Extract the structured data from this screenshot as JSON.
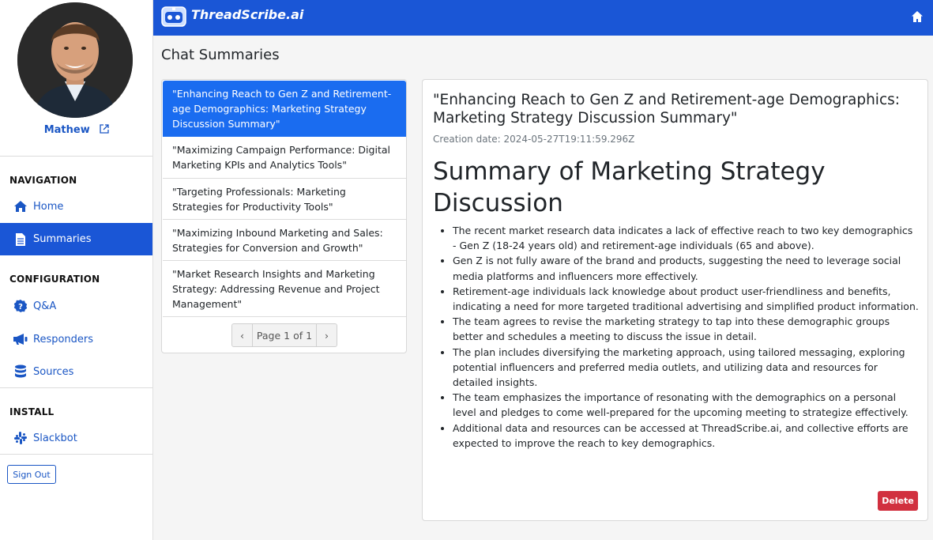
{
  "app": {
    "brand": "ThreadScribe.ai"
  },
  "user": {
    "name": "Mathew"
  },
  "sidebar": {
    "sections": {
      "navigation": "NAVIGATION",
      "configuration": "CONFIGURATION",
      "install": "INSTALL"
    },
    "items": [
      {
        "label": "Home",
        "icon": "home-icon"
      },
      {
        "label": "Summaries",
        "icon": "document-icon",
        "active": true
      },
      {
        "label": "Q&A",
        "icon": "question-icon"
      },
      {
        "label": "Responders",
        "icon": "megaphone-icon"
      },
      {
        "label": "Sources",
        "icon": "database-icon"
      },
      {
        "label": "Slackbot",
        "icon": "slack-icon"
      }
    ],
    "signout_label": "Sign Out"
  },
  "page": {
    "title": "Chat Summaries"
  },
  "summaries": [
    "\"Enhancing Reach to Gen Z and Retirement-age Demographics: Marketing Strategy Discussion Summary\"",
    "\"Maximizing Campaign Performance: Digital Marketing KPIs and Analytics Tools\"",
    "\"Targeting Professionals: Marketing Strategies for Productivity Tools\"",
    "\"Maximizing Inbound Marketing and Sales: Strategies for Conversion and Growth\"",
    "\"Market Research Insights and Marketing Strategy: Addressing Revenue and Project Management\""
  ],
  "pager": {
    "prev": "‹",
    "label": "Page 1 of 1",
    "next": "›"
  },
  "detail": {
    "title": "\"Enhancing Reach to Gen Z and Retirement-age Demographics: Marketing Strategy Discussion Summary\"",
    "creation_date": "Creation date: 2024-05-27T19:11:59.296Z",
    "heading": "Summary of Marketing Strategy Discussion",
    "bullets": [
      "The recent market research data indicates a lack of effective reach to two key demographics - Gen Z (18-24 years old) and retirement-age individuals (65 and above).",
      "Gen Z is not fully aware of the brand and products, suggesting the need to leverage social media platforms and influencers more effectively.",
      "Retirement-age individuals lack knowledge about product user-friendliness and benefits, indicating a need for more targeted traditional advertising and simplified product information.",
      "The team agrees to revise the marketing strategy to tap into these demographic groups better and schedules a meeting to discuss the issue in detail.",
      "The plan includes diversifying the marketing approach, using tailored messaging, exploring potential influencers and preferred media outlets, and utilizing data and resources for detailed insights.",
      "The team emphasizes the importance of resonating with the demographics on a personal level and pledges to come well-prepared for the upcoming meeting to strategize effectively.",
      "Additional data and resources can be accessed at ThreadScribe.ai, and collective efforts are expected to improve the reach to key demographics."
    ],
    "delete_label": "Delete"
  },
  "colors": {
    "primary": "#1a56d6",
    "active_item": "#1a6cf0",
    "danger": "#d1303f"
  }
}
